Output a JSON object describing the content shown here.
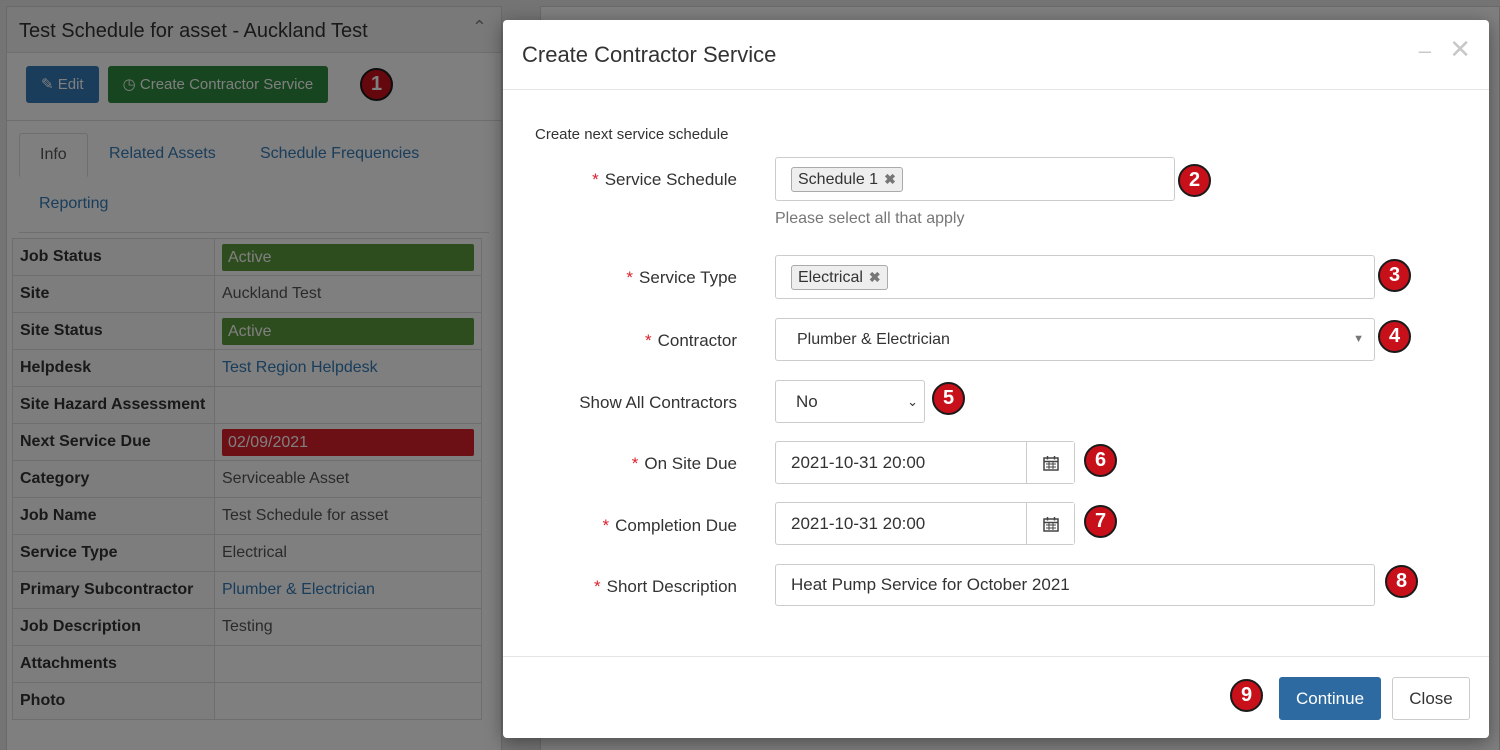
{
  "background": {
    "panel_title": "Test Schedule for asset - Auckland Test",
    "edit_label": "Edit",
    "create_label": "Create Contractor Service",
    "callout_1": "1",
    "tabs": [
      "Info",
      "Related Assets",
      "Schedule Frequencies",
      "Reporting"
    ],
    "rows": [
      {
        "label": "Job Status",
        "value": "Active"
      },
      {
        "label": "Site",
        "value": "Auckland Test"
      },
      {
        "label": "Site Status",
        "value": "Active"
      },
      {
        "label": "Helpdesk",
        "value": "Test Region Helpdesk"
      },
      {
        "label": "Site Hazard Assessment",
        "value": ""
      },
      {
        "label": "Next Service Due",
        "value": "02/09/2021"
      },
      {
        "label": "Category",
        "value": "Serviceable Asset"
      },
      {
        "label": "Job Name",
        "value": "Test Schedule for asset"
      },
      {
        "label": "Service Type",
        "value": "Electrical"
      },
      {
        "label": "Primary Subcontractor",
        "value": "Plumber & Electrician"
      },
      {
        "label": "Job Description",
        "value": "Testing"
      },
      {
        "label": "Attachments",
        "value": ""
      },
      {
        "label": "Photo",
        "value": ""
      }
    ]
  },
  "modal": {
    "title": "Create Contractor Service",
    "intro": "Create next service schedule",
    "fields": {
      "service_schedule": {
        "label": "Service Schedule",
        "tag": "Schedule 1",
        "help": "Please select all that apply",
        "callout": "2"
      },
      "service_type": {
        "label": "Service Type",
        "tag": "Electrical",
        "callout": "3"
      },
      "contractor": {
        "label": "Contractor",
        "value": "Plumber & Electrician",
        "callout": "4"
      },
      "show_all": {
        "label": "Show All Contractors",
        "value": "No",
        "callout": "5"
      },
      "on_site_due": {
        "label": "On Site Due",
        "value": "2021-10-31 20:00",
        "callout": "6"
      },
      "completion_due": {
        "label": "Completion Due",
        "value": "2021-10-31 20:00",
        "callout": "7"
      },
      "short_description": {
        "label": "Short Description",
        "value": "Heat Pump Service for October 2021",
        "callout": "8"
      }
    },
    "continue_label": "Continue",
    "close_label": "Close",
    "callout_9": "9"
  },
  "colors": {
    "primary": "#337ab7",
    "success": "#2e8b3e",
    "active_status": "#5c9a3c",
    "overdue": "#d9202c",
    "callout": "#c8101a"
  },
  "icons": [
    "edit-icon",
    "clock-icon",
    "chevron-up-icon",
    "minimize-icon",
    "close-icon",
    "remove-tag-icon",
    "dropdown-caret-icon",
    "calendar-icon"
  ]
}
